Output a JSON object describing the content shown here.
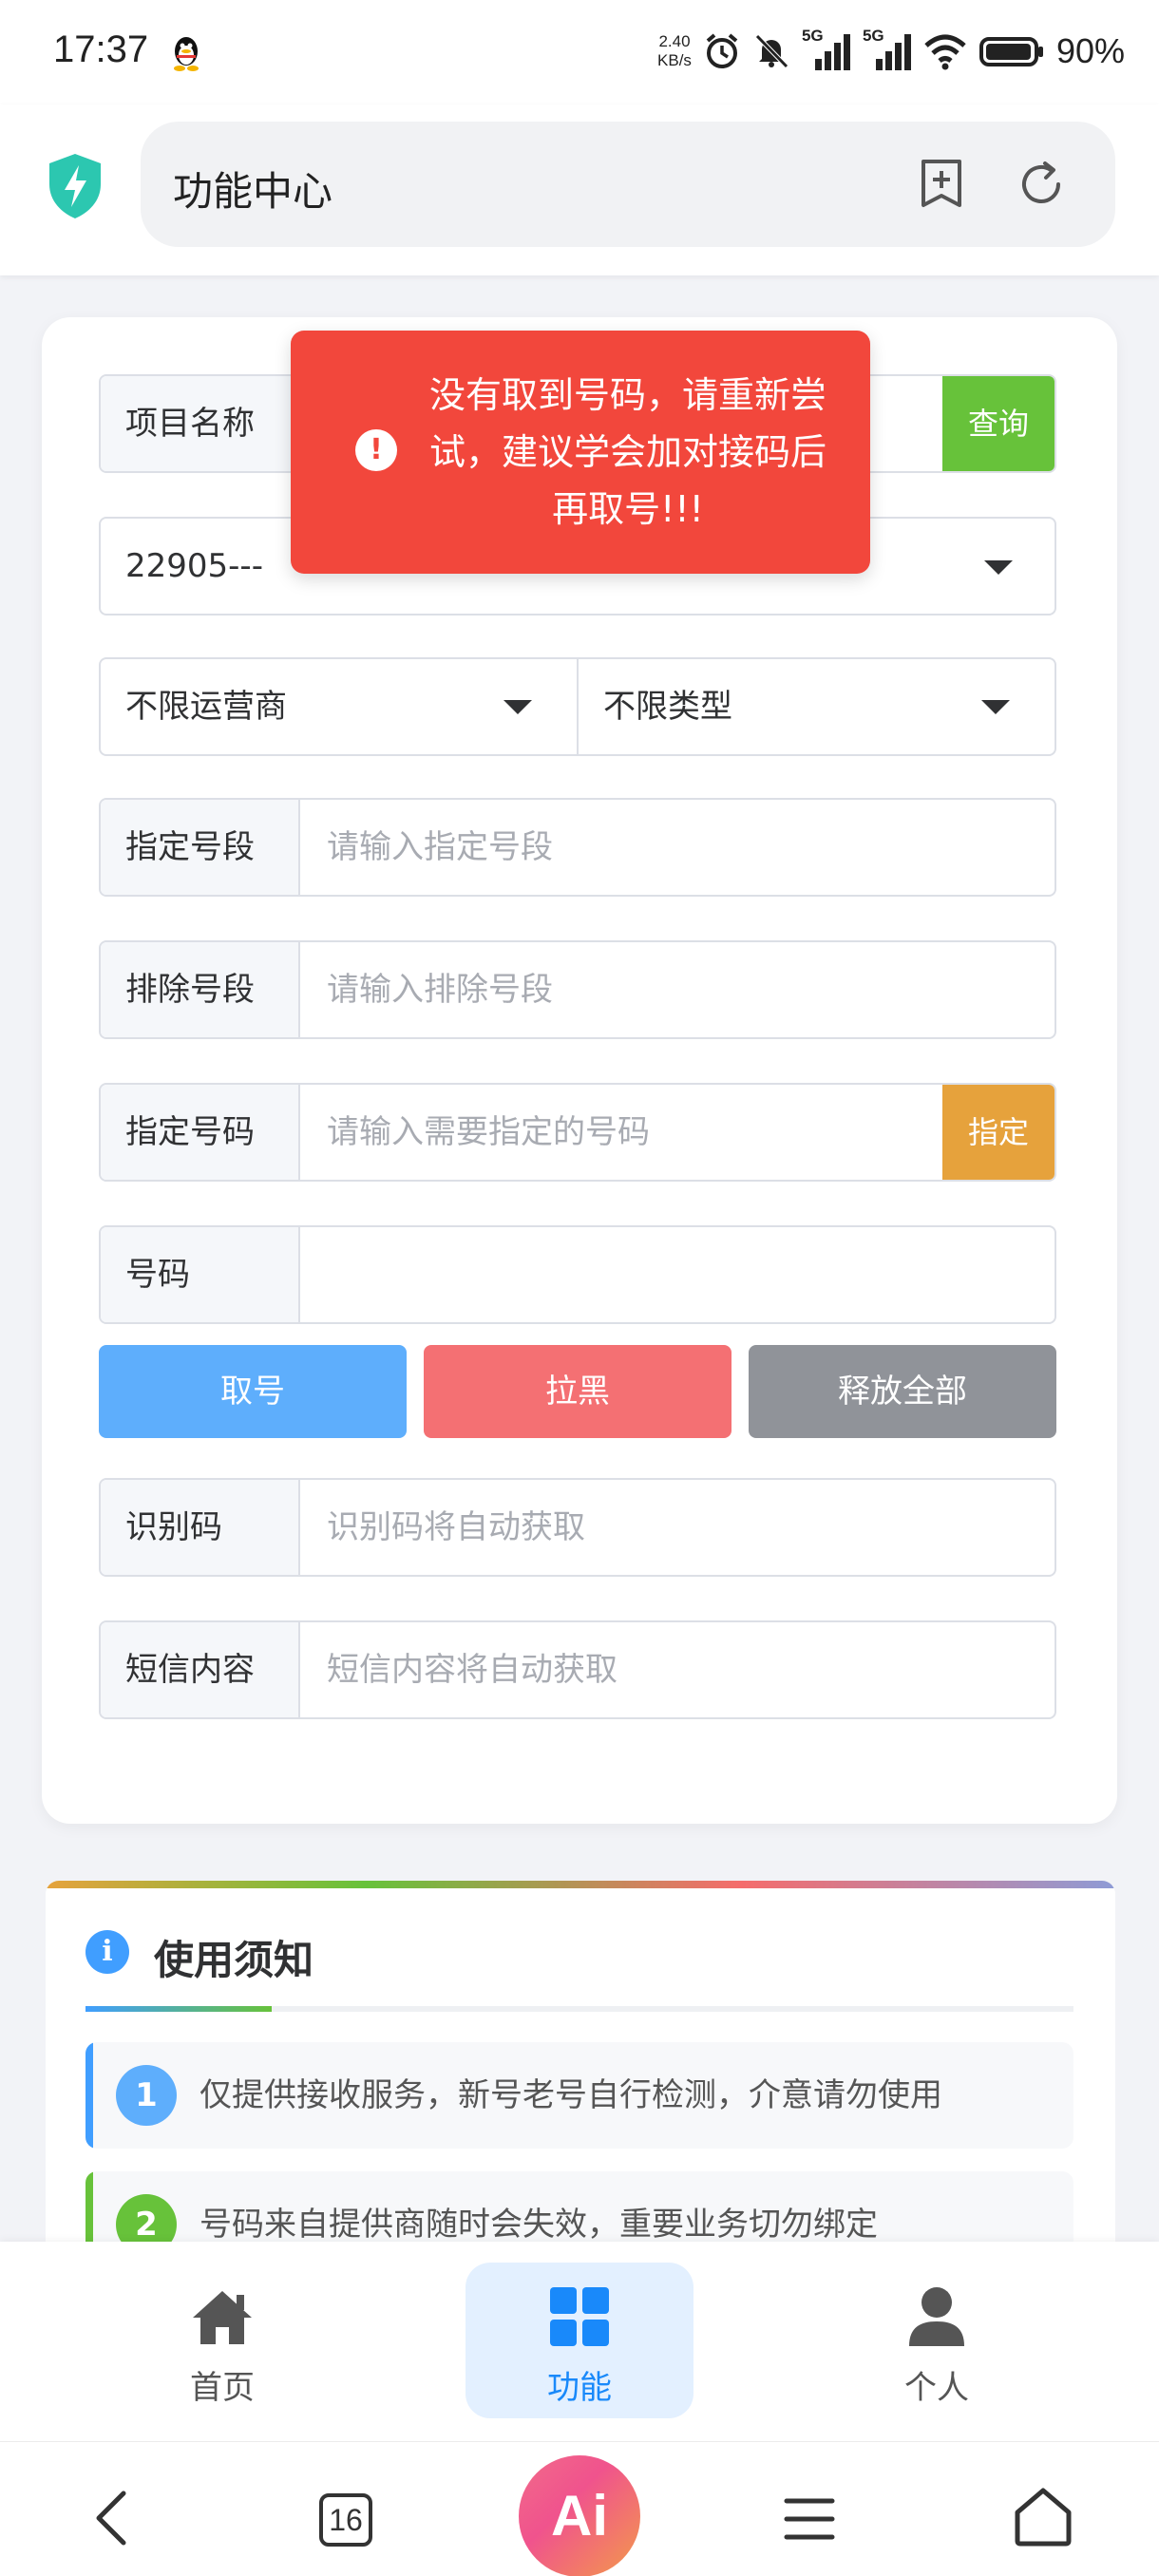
{
  "status_bar": {
    "time": "17:37",
    "speed_value": "2.40",
    "speed_unit": "KB/s",
    "network_1": "5G",
    "network_2": "5G",
    "battery": "90%"
  },
  "browser": {
    "title": "功能中心",
    "icons": [
      "shield-lightning-icon",
      "add-bookmark-icon",
      "reload-icon"
    ]
  },
  "toast": {
    "message": "没有取到号码，请重新尝试，建议学会加对接码后再取号!!!",
    "color": "#f2473c"
  },
  "form": {
    "project_label": "项目名称",
    "query_button": "查询",
    "project_select_value": "22905---",
    "operator_select": "不限运营商",
    "type_select": "不限类型",
    "segment_label": "指定号段",
    "segment_placeholder": "请输入指定号段",
    "exclude_label": "排除号段",
    "exclude_placeholder": "请输入排除号段",
    "number_spec_label": "指定号码",
    "number_spec_placeholder": "请输入需要指定的号码",
    "specify_button": "指定",
    "number_label": "号码",
    "number_value": "",
    "get_button": "取号",
    "block_button": "拉黑",
    "release_button": "释放全部",
    "code_label": "识别码",
    "code_placeholder": "识别码将自动获取",
    "sms_label": "短信内容",
    "sms_placeholder": "短信内容将自动获取"
  },
  "notice": {
    "title": "使用须知",
    "items": [
      {
        "num": "1",
        "text": "仅提供接收服务，新号老号自行检测，介意请勿使用",
        "color": "#409eff"
      },
      {
        "num": "2",
        "text": "号码来自提供商随时会失效，重要业务切勿绑定",
        "color": "#67c23a"
      }
    ]
  },
  "app_nav": {
    "items": [
      {
        "label": "首页",
        "icon": "home-icon"
      },
      {
        "label": "功能",
        "icon": "grid-icon",
        "active": true
      },
      {
        "label": "个人",
        "icon": "person-icon"
      }
    ]
  },
  "system_nav": {
    "tabs_count": "16",
    "ai_label": "Ai"
  },
  "colors": {
    "primary": "#409eff",
    "success": "#67c23a",
    "warning": "#e6a23c",
    "danger": "#f56c6c",
    "info": "#909399"
  }
}
